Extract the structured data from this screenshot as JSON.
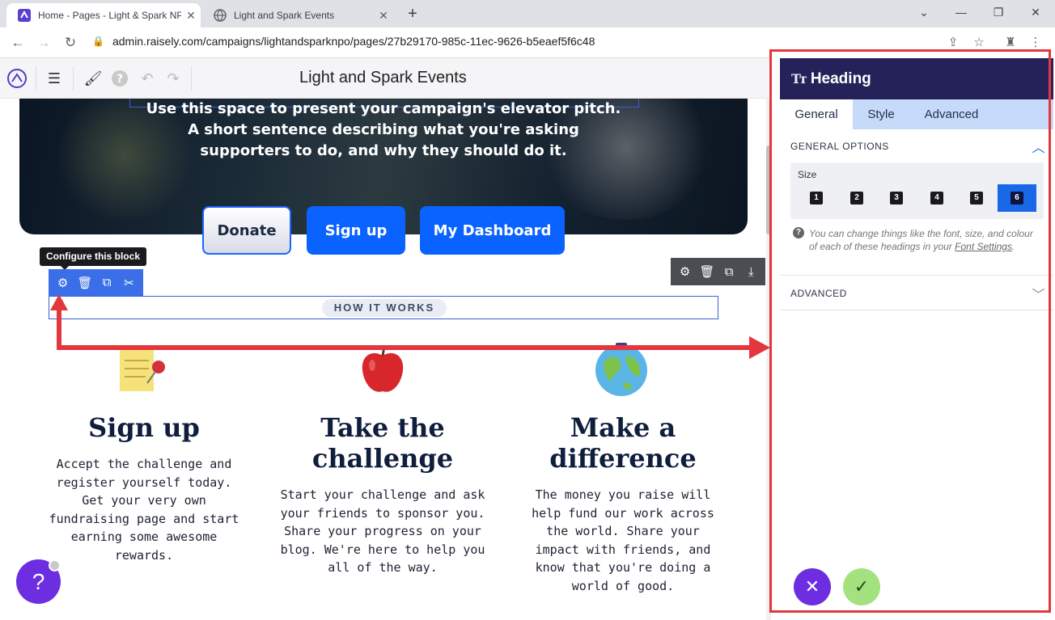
{
  "browser": {
    "tabs": [
      {
        "title": "Home - Pages - Light & Spark NPO",
        "active": true
      },
      {
        "title": "Light and Spark Events",
        "active": false
      }
    ],
    "url": "admin.raisely.com/campaigns/lightandsparknpo/pages/27b29170-985c-11ec-9626-b5eaef5f6c48"
  },
  "app_toolbar": {
    "page_title": "Light and Spark Events"
  },
  "hero": {
    "pitch": "Use this space to present your campaign's elevator pitch. A short sentence describing what you're asking supporters to do, and why they should do it.",
    "buttons": {
      "donate": "Donate",
      "signup": "Sign up",
      "dashboard": "My Dashboard"
    }
  },
  "block": {
    "tooltip": "Configure this block",
    "heading_text": "HOW IT WORKS"
  },
  "steps": [
    {
      "icon": "memo-pin-icon",
      "title": "Sign up",
      "text": "Accept the challenge and register yourself today. Get your very own fundraising page and start earning some awesome rewards."
    },
    {
      "icon": "apple-icon",
      "title": "Take the challenge",
      "text": "Start your challenge and ask your friends to sponsor you. Share your progress on your blog. We're here to help you all of the way."
    },
    {
      "icon": "globe-icon",
      "title": "Make a difference",
      "text": "The money you raise will help fund our work across the world. Share your impact with friends, and know that you're doing a world of good."
    }
  ],
  "help": {
    "label": "?"
  },
  "panel": {
    "title": "Heading",
    "tabs": [
      "General",
      "Style",
      "Advanced"
    ],
    "active_tab": "General",
    "general_options_label": "GENERAL OPTIONS",
    "size_label": "Size",
    "sizes": [
      "1",
      "2",
      "3",
      "4",
      "5",
      "6"
    ],
    "selected_size": "6",
    "note_text": "You can change things like the font, size, and colour of each of these headings in your",
    "note_link": "Font Settings",
    "note_end": ".",
    "advanced_label": "ADVANCED",
    "cancel_icon": "close-icon",
    "confirm_icon": "check-icon"
  },
  "colors": {
    "brand_blue": "#0a63ff",
    "panel_header": "#25225a",
    "annotation_red": "#e3373d",
    "cancel_purple": "#6c2ee0",
    "confirm_green": "#a3e27f"
  }
}
